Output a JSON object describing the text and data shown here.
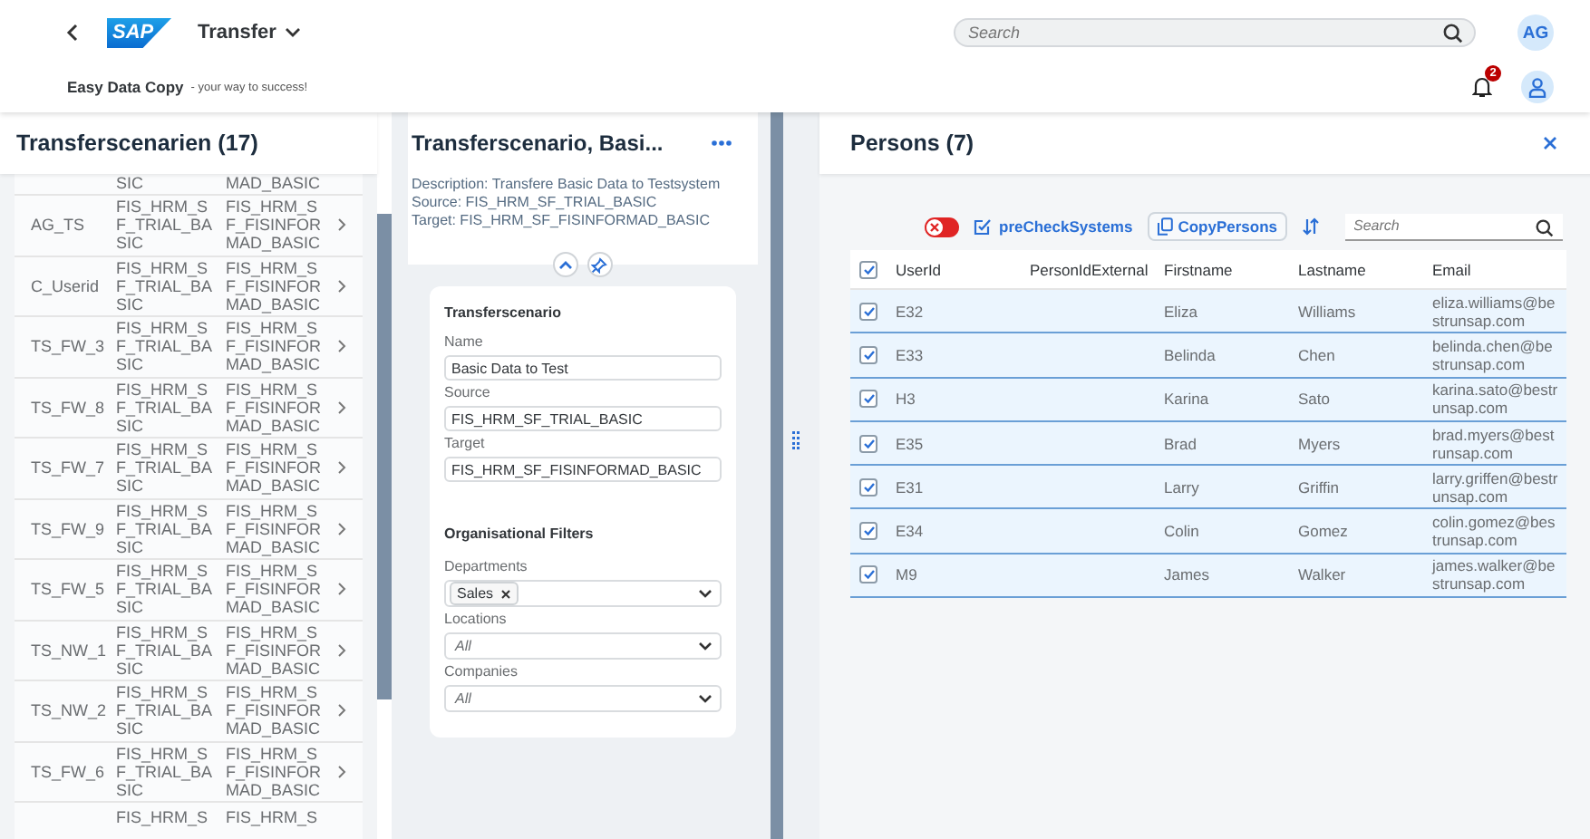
{
  "shell": {
    "title": "Transfer",
    "logo": "SAP",
    "search_placeholder": "Search",
    "avatar": "AG",
    "subtitle": "Easy Data Copy",
    "tagline": "- your way to success!",
    "notification_count": "2"
  },
  "scenarios": {
    "title": "Transferscenarien (17)",
    "rows": [
      {
        "kind": "partial",
        "source": "SIC",
        "target": "MAD_BASIC"
      },
      {
        "kind": "full",
        "id": "AG_TS",
        "source": "FIS_HRM_SF_TRIAL_BASIC",
        "target": "FIS_HRM_SF_FISINFORMAD_BASIC"
      },
      {
        "kind": "full",
        "id": "C_Userid",
        "source": "FIS_HRM_SF_TRIAL_BASIC",
        "target": "FIS_HRM_SF_FISINFORMAD_BASIC"
      },
      {
        "kind": "full",
        "id": "TS_FW_3",
        "source": "FIS_HRM_SF_TRIAL_BASIC",
        "target": "FIS_HRM_SF_FISINFORMAD_BASIC"
      },
      {
        "kind": "full",
        "id": "TS_FW_8",
        "source": "FIS_HRM_SF_TRIAL_BASIC",
        "target": "FIS_HRM_SF_FISINFORMAD_BASIC"
      },
      {
        "kind": "full",
        "id": "TS_FW_7",
        "source": "FIS_HRM_SF_TRIAL_BASIC",
        "target": "FIS_HRM_SF_FISINFORMAD_BASIC"
      },
      {
        "kind": "full",
        "id": "TS_FW_9",
        "source": "FIS_HRM_SF_TRIAL_BASIC",
        "target": "FIS_HRM_SF_FISINFORMAD_BASIC"
      },
      {
        "kind": "full",
        "id": "TS_FW_5",
        "source": "FIS_HRM_SF_TRIAL_BASIC",
        "target": "FIS_HRM_SF_FISINFORMAD_BASIC"
      },
      {
        "kind": "full",
        "id": "TS_NW_1",
        "source": "FIS_HRM_SF_TRIAL_BASIC",
        "target": "FIS_HRM_SF_FISINFORMAD_BASIC"
      },
      {
        "kind": "full",
        "id": "TS_NW_2",
        "source": "FIS_HRM_SF_TRIAL_BASIC",
        "target": "FIS_HRM_SF_FISINFORMAD_BASIC"
      },
      {
        "kind": "full",
        "id": "TS_FW_6",
        "source": "FIS_HRM_SF_TRIAL_BASIC",
        "target": "FIS_HRM_SF_FISINFORMAD_BASIC"
      },
      {
        "kind": "cut",
        "source": "FIS_HRM_S",
        "target": "FIS_HRM_S"
      }
    ]
  },
  "detail": {
    "title": "Transferscenario, Basi...",
    "description": "Description: Transfere Basic Data to Testsystem",
    "source": "Source: FIS_HRM_SF_TRIAL_BASIC",
    "target": "Target: FIS_HRM_SF_FISINFORMAD_BASIC",
    "form_title": "Transferscenario",
    "fields": [
      {
        "label": "Name",
        "value": "Basic Data to Test"
      },
      {
        "label": "Source",
        "value": "FIS_HRM_SF_TRIAL_BASIC"
      },
      {
        "label": "Target",
        "value": "FIS_HRM_SF_FISINFORMAD_BASIC"
      }
    ],
    "filters_title": "Organisational Filters",
    "filters": [
      {
        "label": "Departments",
        "tokens": [
          "Sales"
        ]
      },
      {
        "label": "Locations",
        "placeholder": "All"
      },
      {
        "label": "Companies",
        "placeholder": "All"
      }
    ]
  },
  "persons": {
    "title": "Persons (7)",
    "switch": {
      "on": false
    },
    "precheck": "preCheckSystems",
    "copy": "CopyPersons",
    "search_placeholder": "Search",
    "columns": [
      "UserId",
      "PersonIdExternal",
      "Firstname",
      "Lastname",
      "Email"
    ],
    "all_selected": true,
    "rows": [
      {
        "selected": true,
        "user_id": "E32",
        "first": "Eliza",
        "last": "Williams",
        "email": "eliza.williams@bestrunsap.com"
      },
      {
        "selected": true,
        "user_id": "E33",
        "first": "Belinda",
        "last": "Chen",
        "email": "belinda.chen@bestrunsap.com"
      },
      {
        "selected": true,
        "user_id": "H3",
        "first": "Karina",
        "last": "Sato",
        "email": "karina.sato@bestrunsap.com"
      },
      {
        "selected": true,
        "user_id": "E35",
        "first": "Brad",
        "last": "Myers",
        "email": "brad.myers@bestrunsap.com"
      },
      {
        "selected": true,
        "user_id": "E31",
        "first": "Larry",
        "last": "Griffin",
        "email": "larry.griffen@bestrunsap.com"
      },
      {
        "selected": true,
        "user_id": "E34",
        "first": "Colin",
        "last": "Gomez",
        "email": "colin.gomez@bestrunsap.com"
      },
      {
        "selected": true,
        "user_id": "M9",
        "first": "James",
        "last": "Walker",
        "email": "james.walker@bestrunsap.com"
      }
    ]
  }
}
